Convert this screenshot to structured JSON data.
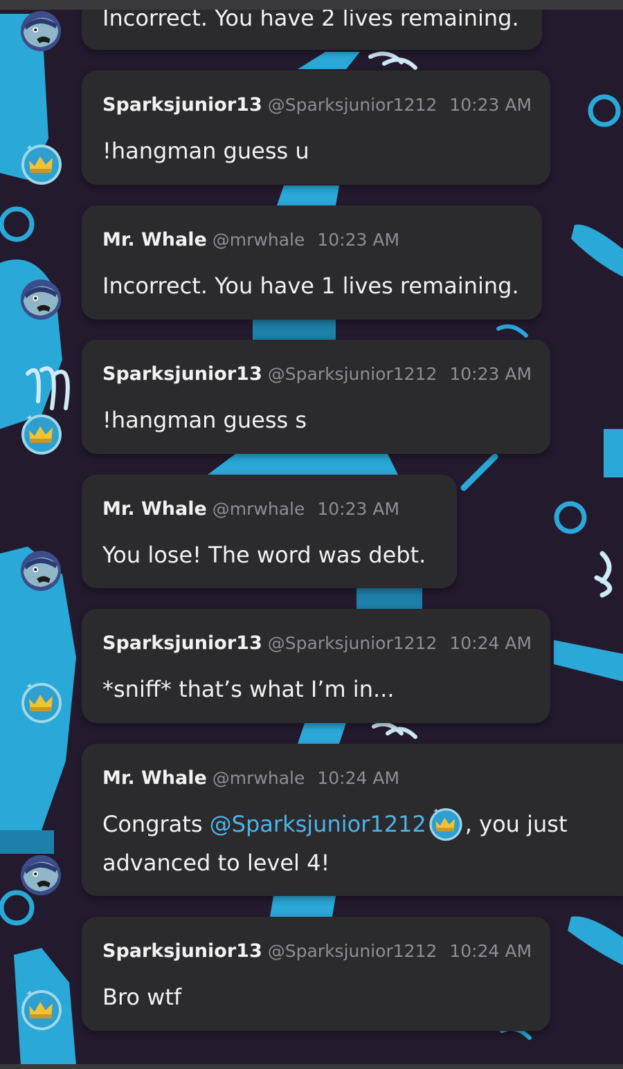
{
  "partial_top_message": {
    "text": "Incorrect. You have 2 lives remaining."
  },
  "messages": [
    {
      "author": "Sparksjunior13",
      "handle": "@Sparksjunior1212",
      "time": "10:23 AM",
      "text": "!hangman guess u"
    },
    {
      "author": "Mr. Whale",
      "handle": "@mrwhale",
      "time": "10:23 AM",
      "text": "Incorrect. You have 1 lives remaining."
    },
    {
      "author": "Sparksjunior13",
      "handle": "@Sparksjunior1212",
      "time": "10:23 AM",
      "text": "!hangman guess s"
    },
    {
      "author": "Mr. Whale",
      "handle": "@mrwhale",
      "time": "10:23 AM",
      "text": "You lose! The word was debt."
    },
    {
      "author": "Sparksjunior13",
      "handle": "@Sparksjunior1212",
      "time": "10:24 AM",
      "text": "*sniff* that’s what I’m in..."
    },
    {
      "author": "Mr. Whale",
      "handle": "@mrwhale",
      "time": "10:24 AM",
      "text_before": "Congrats ",
      "mention": "@Sparksjunior1212",
      "text_after": ", you just",
      "text_line2": "advanced to level 4!"
    },
    {
      "author": "Sparksjunior13",
      "handle": "@Sparksjunior1212",
      "time": "10:24 AM",
      "text": "Bro wtf"
    }
  ],
  "avatars": {
    "mrwhale": "whale-avatar-icon",
    "sparks": "crown-avatar-icon"
  },
  "colors": {
    "bubble": "#2b2b2d",
    "mention": "#4fb3e8",
    "background": "#231a2e",
    "pattern": "#2aa8d8"
  }
}
